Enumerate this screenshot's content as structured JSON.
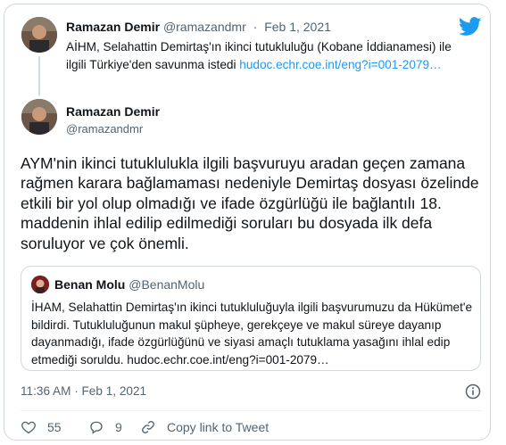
{
  "colors": {
    "accent": "#1d9bf0",
    "text": "#0f1419",
    "muted": "#536471",
    "border": "#cfd9de"
  },
  "parent": {
    "name": "Ramazan Demir",
    "handle": "@ramazandmr",
    "separator": "·",
    "date": "Feb 1, 2021",
    "text": "AİHM, Selahattin Demirtaş'ın ikinci tutukluluğu (Kobane İddianamesi) ile ilgili Türkiye'den savunma istedi ",
    "link": "hudoc.echr.coe.int/eng?i=001-2079…"
  },
  "tweet": {
    "name": "Ramazan Demir",
    "handle": "@ramazandmr",
    "text": "AYM'nin ikinci tutuklulukla ilgili başvuruyu aradan geçen zamana rağmen karara bağlamaması nedeniyle Demirtaş dosyası özelinde etkili bir yol olup olmadığı ve ifade özgürlüğü ile bağlantılı 18. maddenin ihlal edilip edilmediği soruları bu dosyada ilk defa soruluyor ve çok önemli.",
    "timestamp": "11:36 AM · Feb 1, 2021"
  },
  "quote": {
    "name": "Benan Molu",
    "handle": "@BenanMolu",
    "text": "İHAM, Selahattin Demirtaş'ın ikinci tutukluluğuyla ilgili başvurumuzu da Hükümet'e bildirdi. Tutukluluğunun makul şüpheye, gerekçeye ve makul süreye dayanıp dayanmadığı, ifade özgürlüğünü ve siyasi amaçlı tutuklama yasağını ihlal edip etmediği soruldu. hudoc.echr.coe.int/eng?i=001-2079…"
  },
  "actions": {
    "likes": "55",
    "replies": "9",
    "copy_link": "Copy link to Tweet"
  },
  "icons": [
    "twitter-bird-icon",
    "info-icon",
    "heart-icon",
    "reply-icon",
    "link-icon"
  ]
}
